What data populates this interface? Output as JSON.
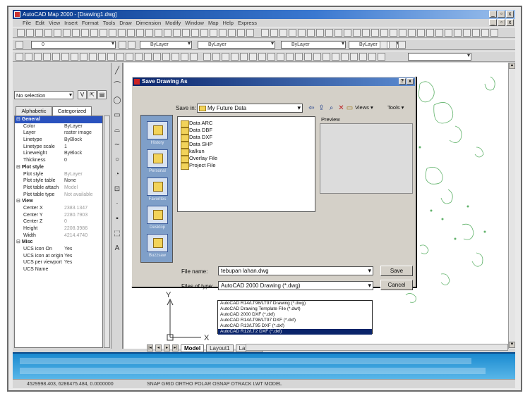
{
  "window": {
    "title": "AutoCAD Map 2000 - [Drawing1.dwg]",
    "minimize": "_",
    "maximize": "▫",
    "close": "x"
  },
  "menubar": [
    "File",
    "Edit",
    "View",
    "Insert",
    "Format",
    "Tools",
    "Draw",
    "Dimension",
    "Modify",
    "Window",
    "Map",
    "Help",
    "Express"
  ],
  "toolbar": {
    "layer_value": "0",
    "linetype_value": "ByLayer",
    "lineweight_value": "ByLayer",
    "color_value": "ByLayer"
  },
  "properties": {
    "selection": "No selection",
    "tabs": [
      "Alphabetic",
      "Categorized"
    ],
    "active_tab": "Categorized",
    "rows": [
      {
        "type": "section",
        "name": "General",
        "selected": true
      },
      {
        "type": "prop",
        "name": "Color",
        "value": "ByLayer"
      },
      {
        "type": "prop",
        "name": "Layer",
        "value": "raster image"
      },
      {
        "type": "prop",
        "name": "Linetype",
        "value": "ByBlock"
      },
      {
        "type": "prop",
        "name": "Linetype scale",
        "value": "1"
      },
      {
        "type": "prop",
        "name": "Lineweight",
        "value": "ByBlock"
      },
      {
        "type": "prop",
        "name": "Thickness",
        "value": "0"
      },
      {
        "type": "section",
        "name": "Plot style"
      },
      {
        "type": "prop",
        "name": "Plot style",
        "value": "ByLayer",
        "grey": true
      },
      {
        "type": "prop",
        "name": "Plot style table",
        "value": "None"
      },
      {
        "type": "prop",
        "name": "Plot table attach",
        "value": "Model",
        "grey": true
      },
      {
        "type": "prop",
        "name": "Plot table type",
        "value": "Not available",
        "grey": true
      },
      {
        "type": "section",
        "name": "View"
      },
      {
        "type": "prop",
        "name": "Center X",
        "value": "2383.1347",
        "grey": true
      },
      {
        "type": "prop",
        "name": "Center Y",
        "value": "2280.7903",
        "grey": true
      },
      {
        "type": "prop",
        "name": "Center Z",
        "value": "0",
        "grey": true
      },
      {
        "type": "prop",
        "name": "Height",
        "value": "2208.3986",
        "grey": true
      },
      {
        "type": "prop",
        "name": "Width",
        "value": "4214.4740",
        "grey": true
      },
      {
        "type": "section",
        "name": "Misc"
      },
      {
        "type": "prop",
        "name": "UCS icon On",
        "value": "Yes"
      },
      {
        "type": "prop",
        "name": "UCS icon at origin",
        "value": "Yes"
      },
      {
        "type": "prop",
        "name": "UCS per viewport",
        "value": "Yes"
      },
      {
        "type": "prop",
        "name": "UCS Name",
        "value": ""
      }
    ]
  },
  "dialog": {
    "title": "Save Drawing As",
    "help": "?",
    "close": "x",
    "save_in_label": "Save in:",
    "save_in_value": "My Future Data",
    "views_label": "Views ▾",
    "tools_label": "Tools ▾",
    "places": [
      "History",
      "Personal",
      "Favorites",
      "Desktop",
      "Buzzsaw"
    ],
    "files": [
      "Data ARC",
      "Data DBF",
      "Data DXF",
      "Data SHP",
      "kalkun",
      "Overlay File",
      "Project File"
    ],
    "preview_label": "Preview",
    "file_name_label": "File name:",
    "file_name_value": "tebupan lahan.dwg",
    "file_type_label": "Files of type:",
    "file_type_value": "AutoCAD 2000 Drawing (*.dwg)",
    "save_button": "Save",
    "cancel_button": "Cancel",
    "file_type_options": [
      "AutoCAD R14/LT98/LT97 Drawing (*.dwg)",
      "AutoCAD Drawing Template File (*.dwt)",
      "AutoCAD 2000 DXF (*.dxf)",
      "AutoCAD R14/LT98/LT97 DXF (*.dxf)",
      "AutoCAD R13/LT95 DXF (*.dxf)",
      "AutoCAD R12/LT2 DXF (*.dxf)"
    ]
  },
  "model_tabs": [
    "Model",
    "Layout1",
    "Layout2"
  ],
  "status": {
    "coords": "4529998.403, 6286475.484, 0.0000000",
    "modes": "SNAP GRID ORTHO POLAR OSNAP OTRACK LWT MODEL"
  },
  "colors": {
    "titlebar": "#0a3a8c",
    "command_line": "#1a8ad0",
    "places_bar": "#7f9fc8",
    "drawing_lines": "#3aa046"
  },
  "icons": [
    "app-icon",
    "folder-icon",
    "up-folder-icon",
    "new-folder-icon",
    "back-icon",
    "delete-icon",
    "ucs-icon",
    "search-icon",
    "pointer-icon"
  ]
}
